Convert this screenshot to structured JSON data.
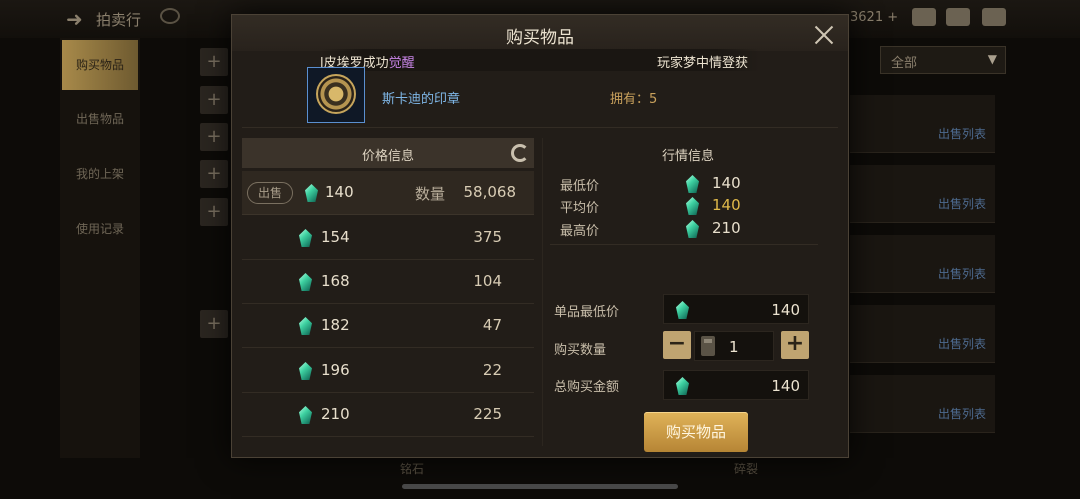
{
  "background": {
    "title": "拍卖行",
    "currency_partial": "3621",
    "filter": "全部",
    "side_items": [
      "购买物品",
      "出售物品",
      "我的上架",
      "使用记录"
    ],
    "sell_list_link": "出售列表",
    "bottom_labels": [
      "铭石",
      "碎裂"
    ]
  },
  "modal": {
    "title": "购买物品",
    "ticker_left_prefix": "l皮埃罗成功",
    "ticker_left_highlight": "觉醒",
    "ticker_right": "玩家梦中情登获⁠",
    "item": {
      "name": "斯卡迪的印章",
      "owned": "拥有：5"
    },
    "price_table": {
      "header": "价格信息",
      "sell_tag": "出售",
      "qty_label": "数量",
      "rows": [
        {
          "price": "140",
          "qty": "58,068"
        },
        {
          "price": "154",
          "qty": "375"
        },
        {
          "price": "168",
          "qty": "104"
        },
        {
          "price": "182",
          "qty": "47"
        },
        {
          "price": "196",
          "qty": "22"
        },
        {
          "price": "210",
          "qty": "225"
        }
      ]
    },
    "market_info": {
      "title": "行情信息",
      "min_label": "最低价",
      "min_value": "140",
      "avg_label": "平均价",
      "avg_value": "140",
      "max_label": "最高价",
      "max_value": "210"
    },
    "form": {
      "unit_min_label": "单品最低价",
      "unit_min_value": "140",
      "quantity_label": "购买数量",
      "quantity_value": "1",
      "total_label": "总购买金额",
      "total_value": "140",
      "buy_button": "购买物品"
    }
  }
}
